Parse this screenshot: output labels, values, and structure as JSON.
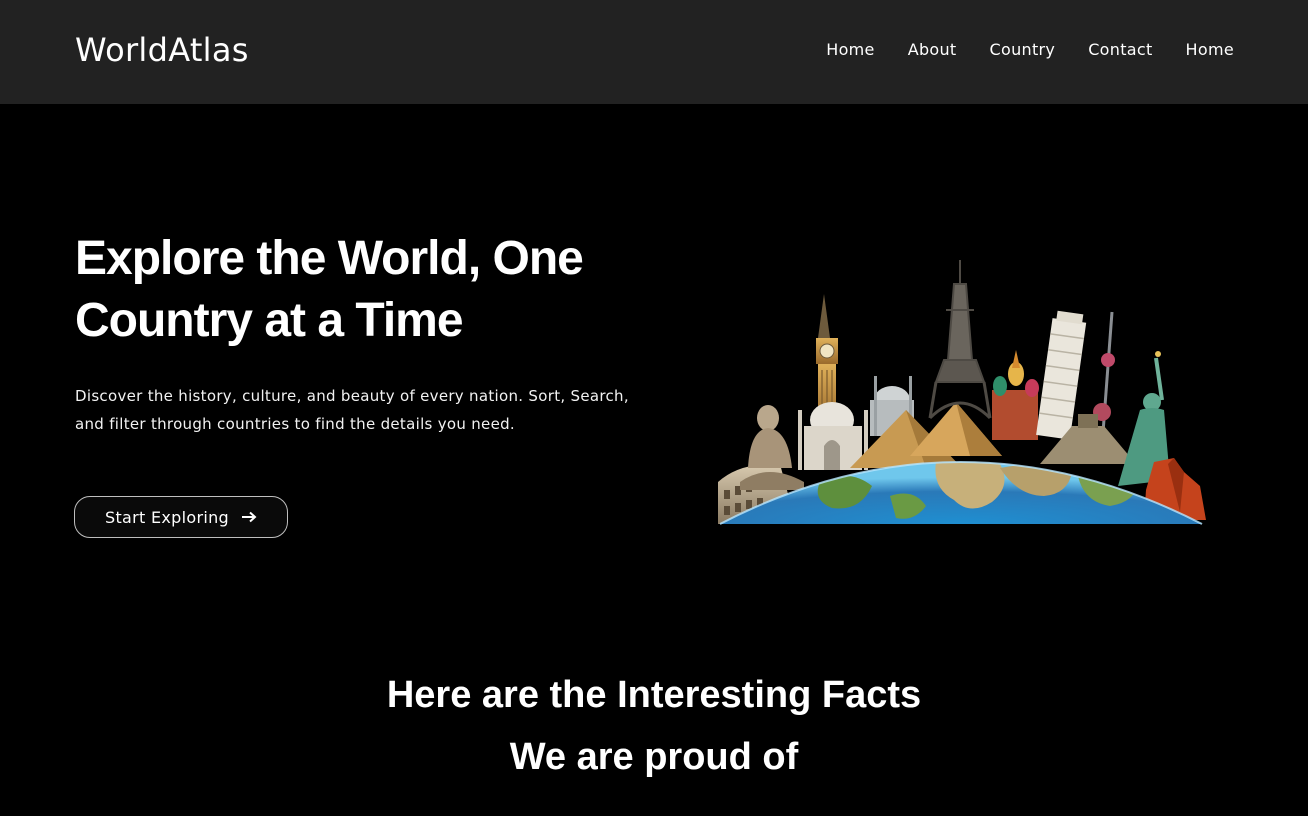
{
  "brand": {
    "logo_text": "WorldAtlas"
  },
  "nav": {
    "items": [
      {
        "label": "Home"
      },
      {
        "label": "About"
      },
      {
        "label": "Country"
      },
      {
        "label": "Contact"
      },
      {
        "label": "Home"
      }
    ]
  },
  "hero": {
    "title_line1": "Explore the World, One",
    "title_line2": "Country at a Time",
    "description": "Discover the history, culture, and beauty of every nation. Sort, Search, and filter through countries to find the details you need.",
    "cta_label": "Start Exploring",
    "cta_icon": "arrow-right-icon",
    "illustration": "world-landmarks-globe"
  },
  "facts": {
    "heading_line1": "Here are the Interesting Facts",
    "heading_line2": "We are proud of"
  },
  "colors": {
    "background": "#000000",
    "navbar": "#222222",
    "text": "#ffffff"
  }
}
